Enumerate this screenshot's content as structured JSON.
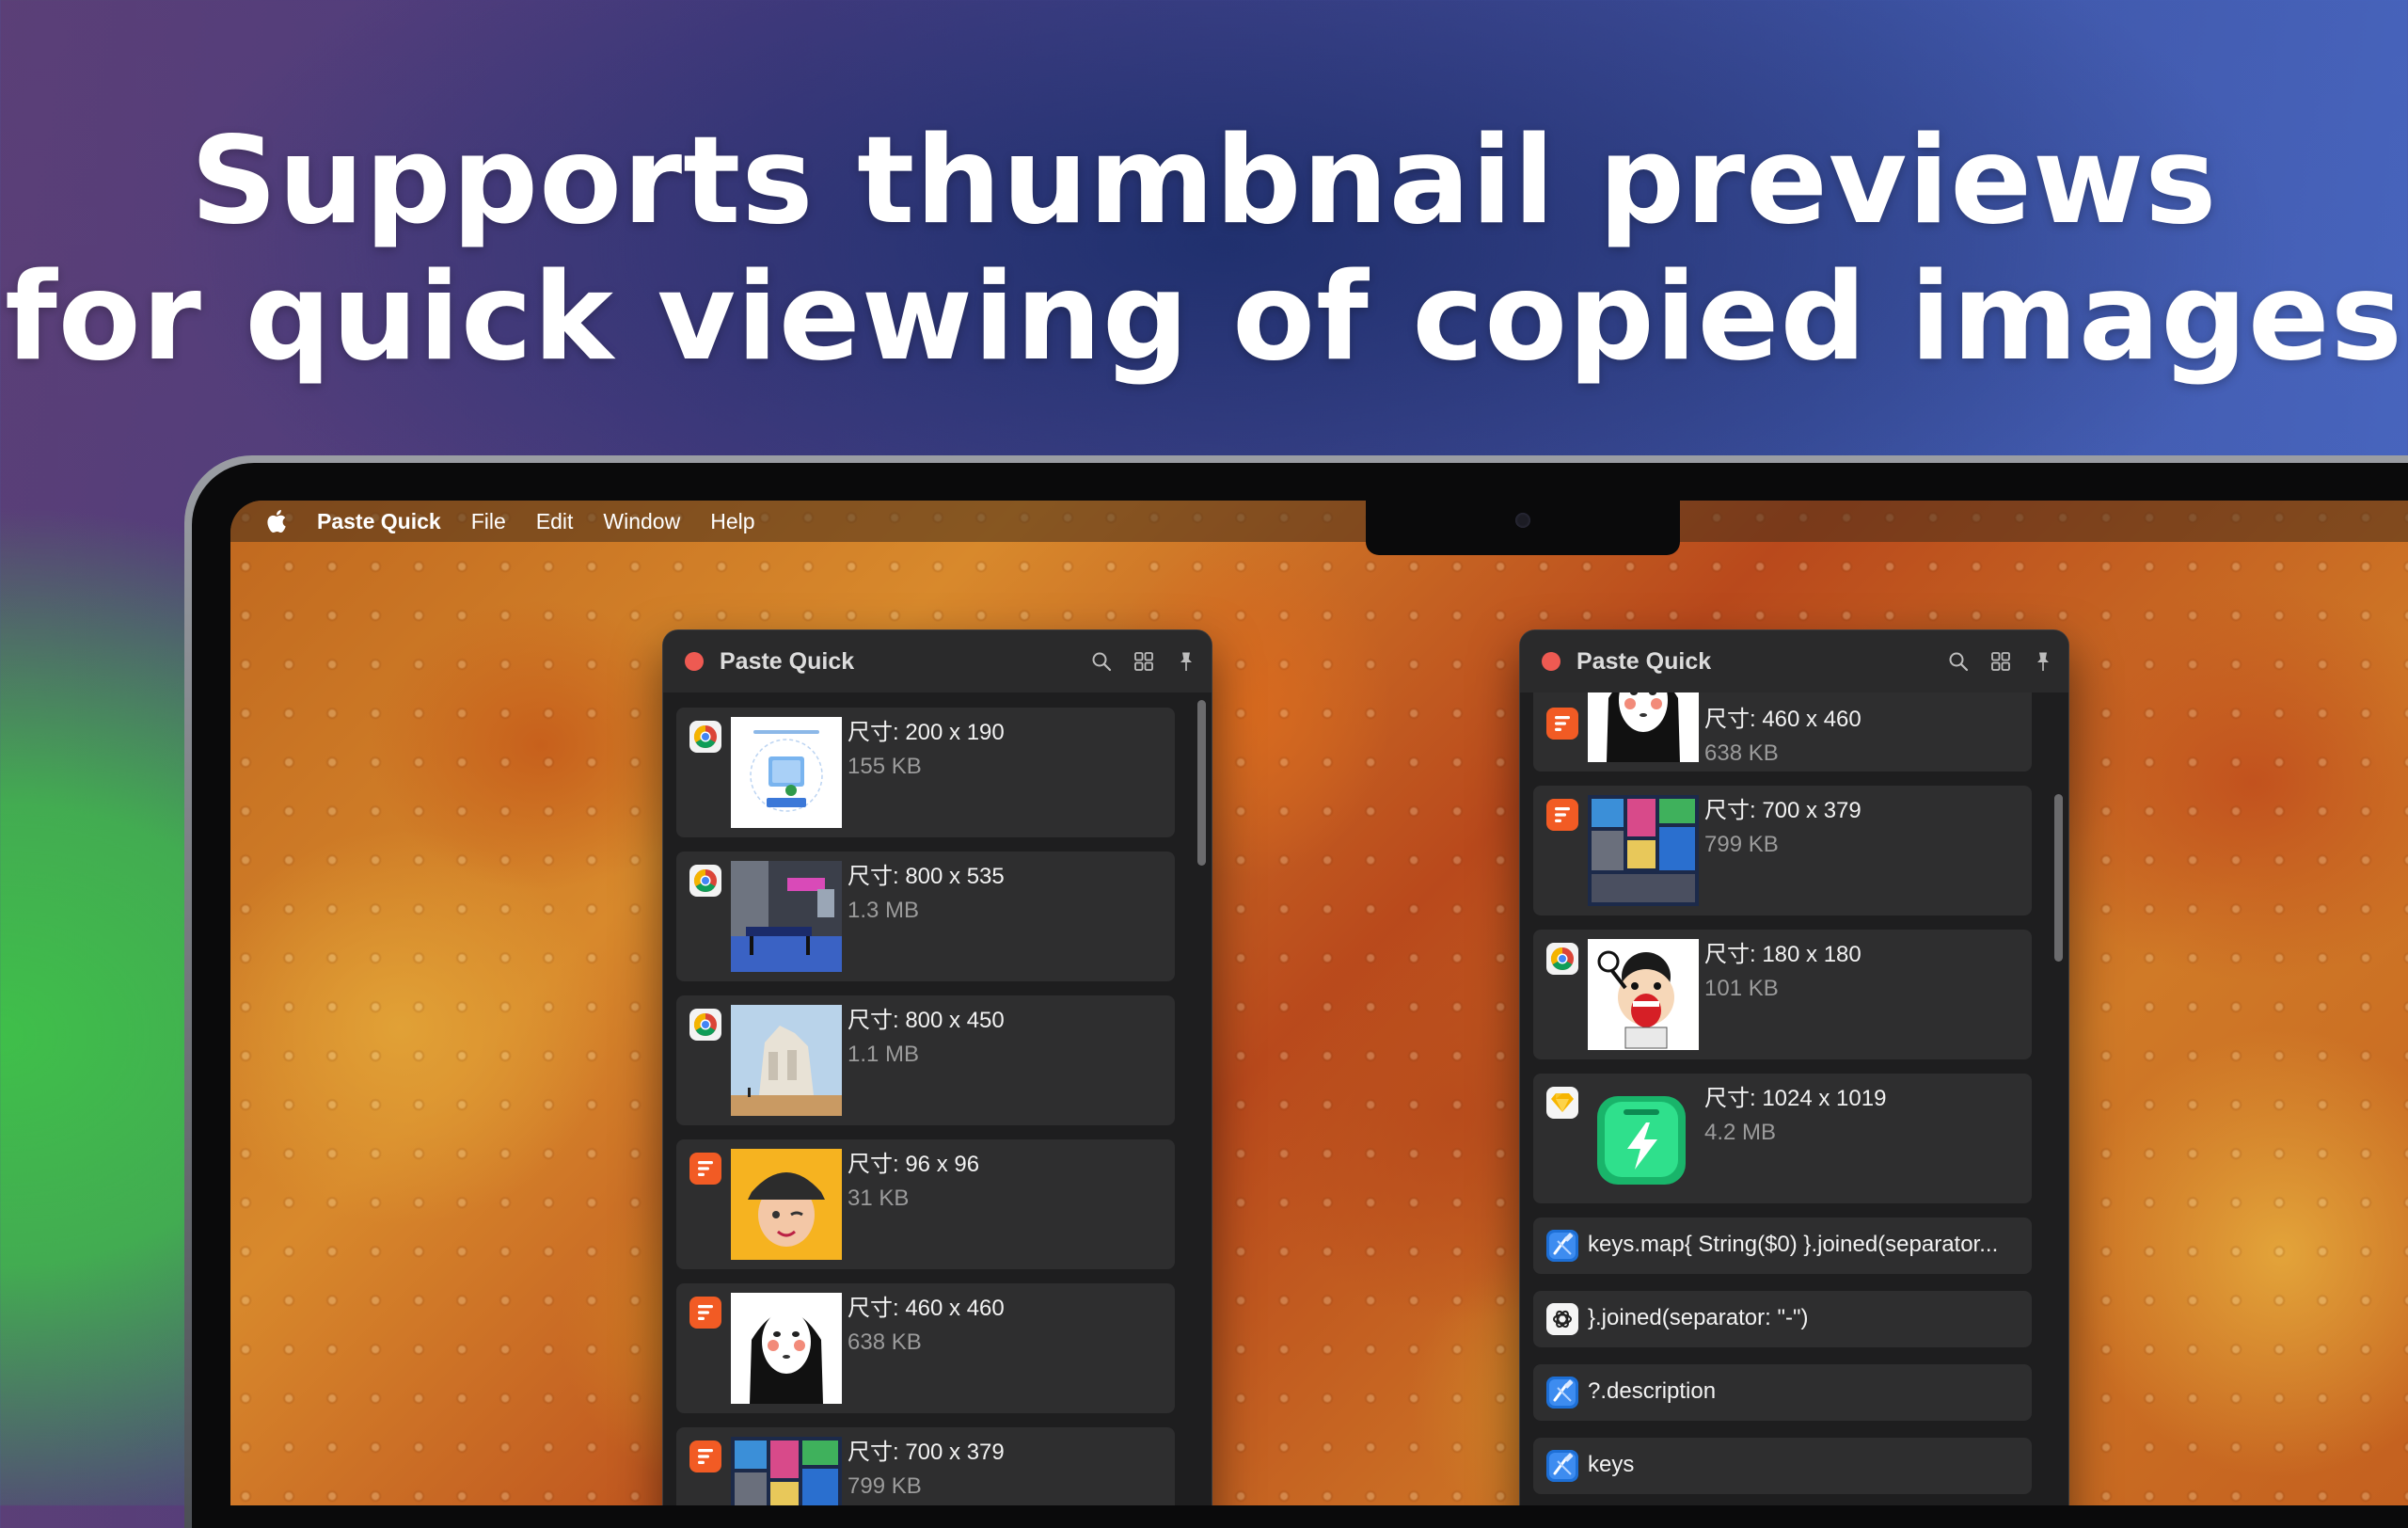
{
  "headline": {
    "line1": "Supports thumbnail previews",
    "line2": "for quick viewing of copied images"
  },
  "menubar": {
    "app_name": "Paste Quick",
    "items": [
      "File",
      "Edit",
      "Window",
      "Help"
    ]
  },
  "left_panel": {
    "title": "Paste Quick",
    "items": [
      {
        "app_icon": "chrome-icon",
        "thumbnail": "templates-screenshot",
        "size": "尺寸: 200 x 190",
        "bytes": "155 KB"
      },
      {
        "app_icon": "chrome-icon",
        "thumbnail": "game-room-photo",
        "size": "尺寸: 800 x 535",
        "bytes": "1.3 MB"
      },
      {
        "app_icon": "chrome-icon",
        "thumbnail": "temple-photo",
        "size": "尺寸: 800 x 450",
        "bytes": "1.1 MB"
      },
      {
        "app_icon": "feishu-icon",
        "thumbnail": "memoji-avatar",
        "size": "尺寸: 96 x 96",
        "bytes": "31 KB"
      },
      {
        "app_icon": "feishu-icon",
        "thumbnail": "no-face-character",
        "size": "尺寸: 460 x 460",
        "bytes": "638 KB"
      },
      {
        "app_icon": "feishu-icon",
        "thumbnail": "collage-image",
        "size": "尺寸: 700 x 379",
        "bytes": "799 KB"
      }
    ]
  },
  "right_panel": {
    "title": "Paste Quick",
    "image_items": [
      {
        "app_icon": "feishu-icon",
        "thumbnail": "no-face-character",
        "size": "尺寸: 460 x 460",
        "bytes": "638 KB"
      },
      {
        "app_icon": "feishu-icon",
        "thumbnail": "collage-image",
        "size": "尺寸: 700 x 379",
        "bytes": "799 KB"
      },
      {
        "app_icon": "chrome-icon",
        "thumbnail": "cartoon-sticker",
        "size": "尺寸: 180 x 180",
        "bytes": "101 KB"
      },
      {
        "app_icon": "sketch-icon",
        "thumbnail": "green-app-icon",
        "size": "尺寸: 1024 x 1019",
        "bytes": "4.2 MB"
      }
    ],
    "text_items": [
      {
        "app_icon": "xcode-icon",
        "text": "keys.map{ String($0) }.joined(separator..."
      },
      {
        "app_icon": "chatgpt-icon",
        "text": "}.joined(separator: \"-\")"
      },
      {
        "app_icon": "xcode-icon",
        "text": "?.description"
      },
      {
        "app_icon": "xcode-icon",
        "text": "keys"
      }
    ]
  },
  "colors": {
    "panel_bg": "#1e1e1f",
    "item_bg": "#2e2e2f",
    "close_button": "#ee5a52",
    "secondary_text": "#9b9b9b"
  }
}
